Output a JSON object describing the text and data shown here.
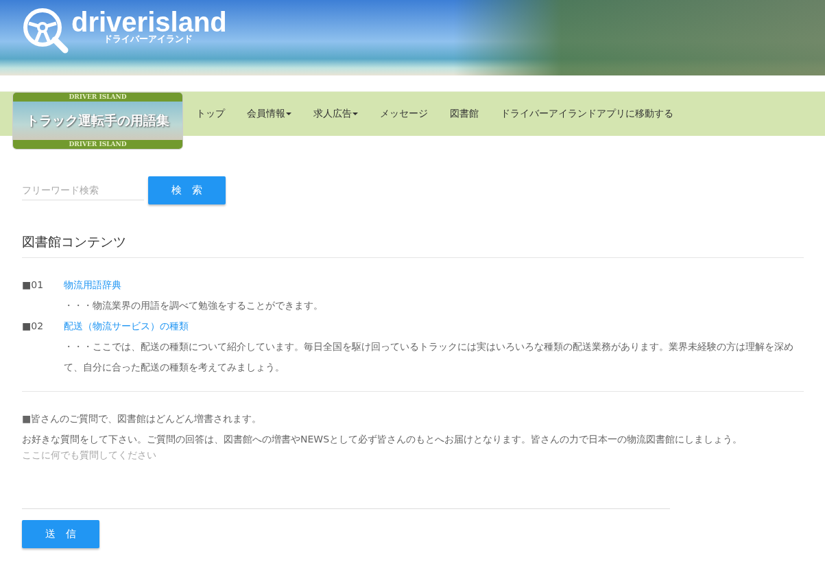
{
  "header": {
    "logo": {
      "wordmark": "driverisland",
      "kana": "ドライバーアイランド"
    }
  },
  "badge": {
    "top": "DRIVER ISLAND",
    "title": "トラック運転手の用語集",
    "bottom": "DRIVER ISLAND"
  },
  "nav": [
    {
      "label": "トップ",
      "dropdown": false
    },
    {
      "label": "会員情報",
      "dropdown": true
    },
    {
      "label": "求人広告",
      "dropdown": true
    },
    {
      "label": "メッセージ",
      "dropdown": false
    },
    {
      "label": "図書館",
      "dropdown": false
    },
    {
      "label": "ドライバーアイランドアプリに移動する",
      "dropdown": false
    }
  ],
  "search": {
    "placeholder": "フリーワード検索",
    "button": "検　索"
  },
  "library": {
    "heading": "図書館コンテンツ",
    "items": [
      {
        "number": "■01",
        "title": "物流用語辞典",
        "description": "・・・物流業界の用語を調べて勉強をすることができます。"
      },
      {
        "number": "■02",
        "title": "配送（物流サービス）の種類",
        "description": "・・・ここでは、配送の種類について紹介しています。毎日全国を駆け回っているトラックには実はいろいろな種類の配送業務があります。業界未経験の方は理解を深めて、自分に合った配送の種類を考えてみましょう。"
      }
    ]
  },
  "question": {
    "lead": "■皆さんのご質問で、図書館はどんどん増書されます。",
    "body": "お好きな質問をして下さい。ご質問の回答は、図書館への増書やNEWSとして必ず皆さんのもとへお届けとなります。皆さんの力で日本一の物流図書館にしましょう。",
    "placeholder": "ここに何でも質問してください",
    "button": "送　信"
  }
}
